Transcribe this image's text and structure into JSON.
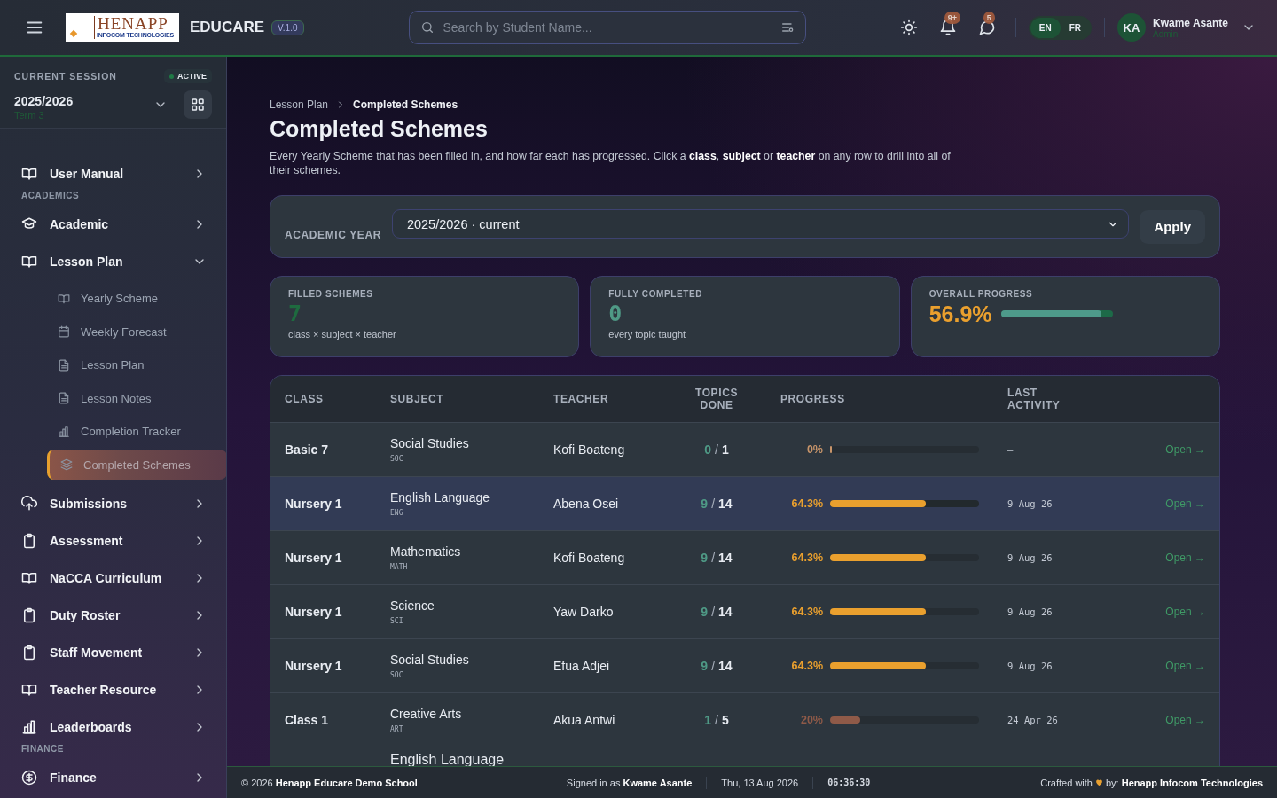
{
  "header": {
    "logo": {
      "name": "HENAPP",
      "tagline": "INFOCOM TECHNOLOGIES"
    },
    "app_name": "EDUCARE",
    "version": "V.1.0",
    "search": {
      "placeholder": "Search by Student Name..."
    },
    "notifications_badge": "9+",
    "messages_badge": "5",
    "languages": [
      {
        "label": "EN",
        "selected": true
      },
      {
        "label": "FR",
        "selected": false
      }
    ],
    "user": {
      "initials": "KA",
      "name": "Kwame Asante",
      "role": "Admin"
    }
  },
  "session": {
    "label": "CURRENT SESSION",
    "status": "ACTIVE",
    "year": "2025/2026",
    "term": "Term 3"
  },
  "sidebar": {
    "items": [
      {
        "kind": "item",
        "label": "User Manual",
        "expanded": false
      },
      {
        "kind": "section",
        "label": "ACADEMICS"
      },
      {
        "kind": "item",
        "label": "Academic",
        "expanded": false
      },
      {
        "kind": "item",
        "label": "Lesson Plan",
        "expanded": true,
        "children": [
          {
            "label": "Yearly Scheme",
            "selected": false
          },
          {
            "label": "Weekly Forecast",
            "selected": false
          },
          {
            "label": "Lesson Plan",
            "selected": false
          },
          {
            "label": "Lesson Notes",
            "selected": false
          },
          {
            "label": "Completion Tracker",
            "selected": false
          },
          {
            "label": "Completed Schemes",
            "selected": true
          }
        ]
      },
      {
        "kind": "item",
        "label": "Submissions",
        "expanded": false
      },
      {
        "kind": "item",
        "label": "Assessment",
        "expanded": false
      },
      {
        "kind": "item",
        "label": "NaCCA Curriculum",
        "expanded": false
      },
      {
        "kind": "item",
        "label": "Duty Roster",
        "expanded": false
      },
      {
        "kind": "item",
        "label": "Staff Movement",
        "expanded": false
      },
      {
        "kind": "item",
        "label": "Teacher Resource",
        "expanded": false
      },
      {
        "kind": "item",
        "label": "Leaderboards",
        "expanded": false
      },
      {
        "kind": "section",
        "label": "FINANCE"
      },
      {
        "kind": "item",
        "label": "Finance",
        "expanded": false
      }
    ]
  },
  "breadcrumb": [
    "Lesson Plan",
    "Completed Schemes"
  ],
  "title": "Completed Schemes",
  "description": "Every Yearly Scheme that has been filled in, and how far each has progressed. Click a **class**, **subject** or **teacher** on any row to drill into all of their schemes.",
  "filter": {
    "label": "ACADEMIC YEAR",
    "value": "2025/2026 · current",
    "button": "Apply"
  },
  "stats": [
    {
      "kind": "count",
      "label": "FILLED SCHEMES",
      "value": "7",
      "note": "class × subject × teacher",
      "color": "#1e6b3f"
    },
    {
      "kind": "count",
      "label": "FULLY COMPLETED",
      "value": "0",
      "note": "every topic taught",
      "color": "#4f9a86"
    },
    {
      "kind": "meter",
      "label": "OVERALL PROGRESS",
      "value": "56.9%",
      "level": 0.9,
      "color": "#eaa02e"
    }
  ],
  "table": {
    "columns": [
      "CLASS",
      "SUBJECT",
      "TEACHER",
      "TOPICS DONE",
      "PROGRESS",
      "LAST ACTIVITY"
    ],
    "rows": [
      {
        "class": "Basic 7",
        "subject": "Social Studies",
        "code": "SOC",
        "teacher": "Kofi Boateng",
        "done": "0",
        "separator": "/",
        "total": "1",
        "percent": "0%",
        "level": 0,
        "color": "#c8956a",
        "last_activity": "–",
        "action": "Open →",
        "selected": false
      },
      {
        "class": "Nursery 1",
        "subject": "English Language",
        "code": "ENG",
        "teacher": "Abena Osei",
        "done": "9",
        "separator": "/",
        "total": "14",
        "percent": "64.3%",
        "level": 0.643,
        "color": "#eaa02e",
        "last_activity": "9 Aug 26",
        "action": "Open →",
        "selected": true
      },
      {
        "class": "Nursery 1",
        "subject": "Mathematics",
        "code": "MATH",
        "teacher": "Kofi Boateng",
        "done": "9",
        "separator": "/",
        "total": "14",
        "percent": "64.3%",
        "level": 0.643,
        "color": "#eaa02e",
        "last_activity": "9 Aug 26",
        "action": "Open →",
        "selected": false
      },
      {
        "class": "Nursery 1",
        "subject": "Science",
        "code": "SCI",
        "teacher": "Yaw Darko",
        "done": "9",
        "separator": "/",
        "total": "14",
        "percent": "64.3%",
        "level": 0.643,
        "color": "#eaa02e",
        "last_activity": "9 Aug 26",
        "action": "Open →",
        "selected": false
      },
      {
        "class": "Nursery 1",
        "subject": "Social Studies",
        "code": "SOC",
        "teacher": "Efua Adjei",
        "done": "9",
        "separator": "/",
        "total": "14",
        "percent": "64.3%",
        "level": 0.643,
        "color": "#eaa02e",
        "last_activity": "9 Aug 26",
        "action": "Open →",
        "selected": false
      },
      {
        "class": "Class 1",
        "subject": "Creative Arts",
        "code": "ART",
        "teacher": "Akua Antwi",
        "done": "1",
        "separator": "/",
        "total": "5",
        "percent": "20%",
        "level": 0.2,
        "color": "#8f5a48",
        "last_activity": "24 Apr 26",
        "action": "Open →",
        "selected": false
      }
    ],
    "partial_row": {
      "subject": "English Language"
    }
  },
  "footer": {
    "copyright": "© 2026 **Henapp Educare Demo School**",
    "signed_in": "Signed in as **Kwame Asante**",
    "date": "Thu, 13 Aug 2026",
    "time": "06:36:30",
    "crafted": "Crafted with",
    "credit": "by: **Henapp Infocom Technologies**"
  }
}
